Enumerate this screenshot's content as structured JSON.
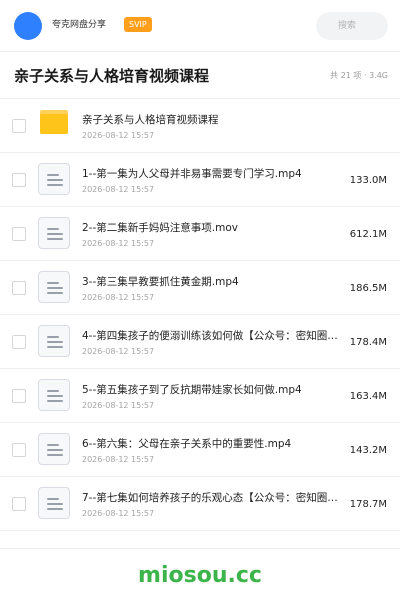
{
  "header": {
    "share_name": "夸克网盘分享",
    "badge": "SVIP",
    "search_placeholder": "搜索"
  },
  "folder": {
    "title": "亲子关系与人格培育视频课程",
    "meta": "共 21 项 · 3.4G"
  },
  "files": [
    {
      "name": "亲子关系与人格培育视频课程",
      "date": "2026-08-12 15:57",
      "size": "",
      "type": "folder"
    },
    {
      "name": "1--第一集为人父母并非易事需要专门学习.mp4",
      "date": "2026-08-12 15:57",
      "size": "133.0M",
      "type": "file"
    },
    {
      "name": "2--第二集新手妈妈注意事项.mov",
      "date": "2026-08-12 15:57",
      "size": "612.1M",
      "type": "file"
    },
    {
      "name": "3--第三集早教要抓住黄金期.mp4",
      "date": "2026-08-12 15:57",
      "size": "186.5M",
      "type": "file"
    },
    {
      "name": "4--第四集孩子的便溺训练该如何做【公众号：密知圈…",
      "date": "2026-08-12 15:57",
      "size": "178.4M",
      "type": "file"
    },
    {
      "name": "5--第五集孩子到了反抗期带娃家长如何做.mp4",
      "date": "2026-08-12 15:57",
      "size": "163.4M",
      "type": "file"
    },
    {
      "name": "6--第六集：父母在亲子关系中的重要性.mp4",
      "date": "2026-08-12 15:57",
      "size": "143.2M",
      "type": "file"
    },
    {
      "name": "7--第七集如何培养孩子的乐观心态【公众号：密知圈…",
      "date": "2026-08-12 15:57",
      "size": "178.7M",
      "type": "file"
    }
  ],
  "footer": {
    "watermark": "miosou.cc"
  },
  "colors": {
    "avatar": "#2f80ff",
    "badge": "#ff9f1c",
    "folder": "#ffc41a",
    "watermark": "#3bb44a"
  }
}
